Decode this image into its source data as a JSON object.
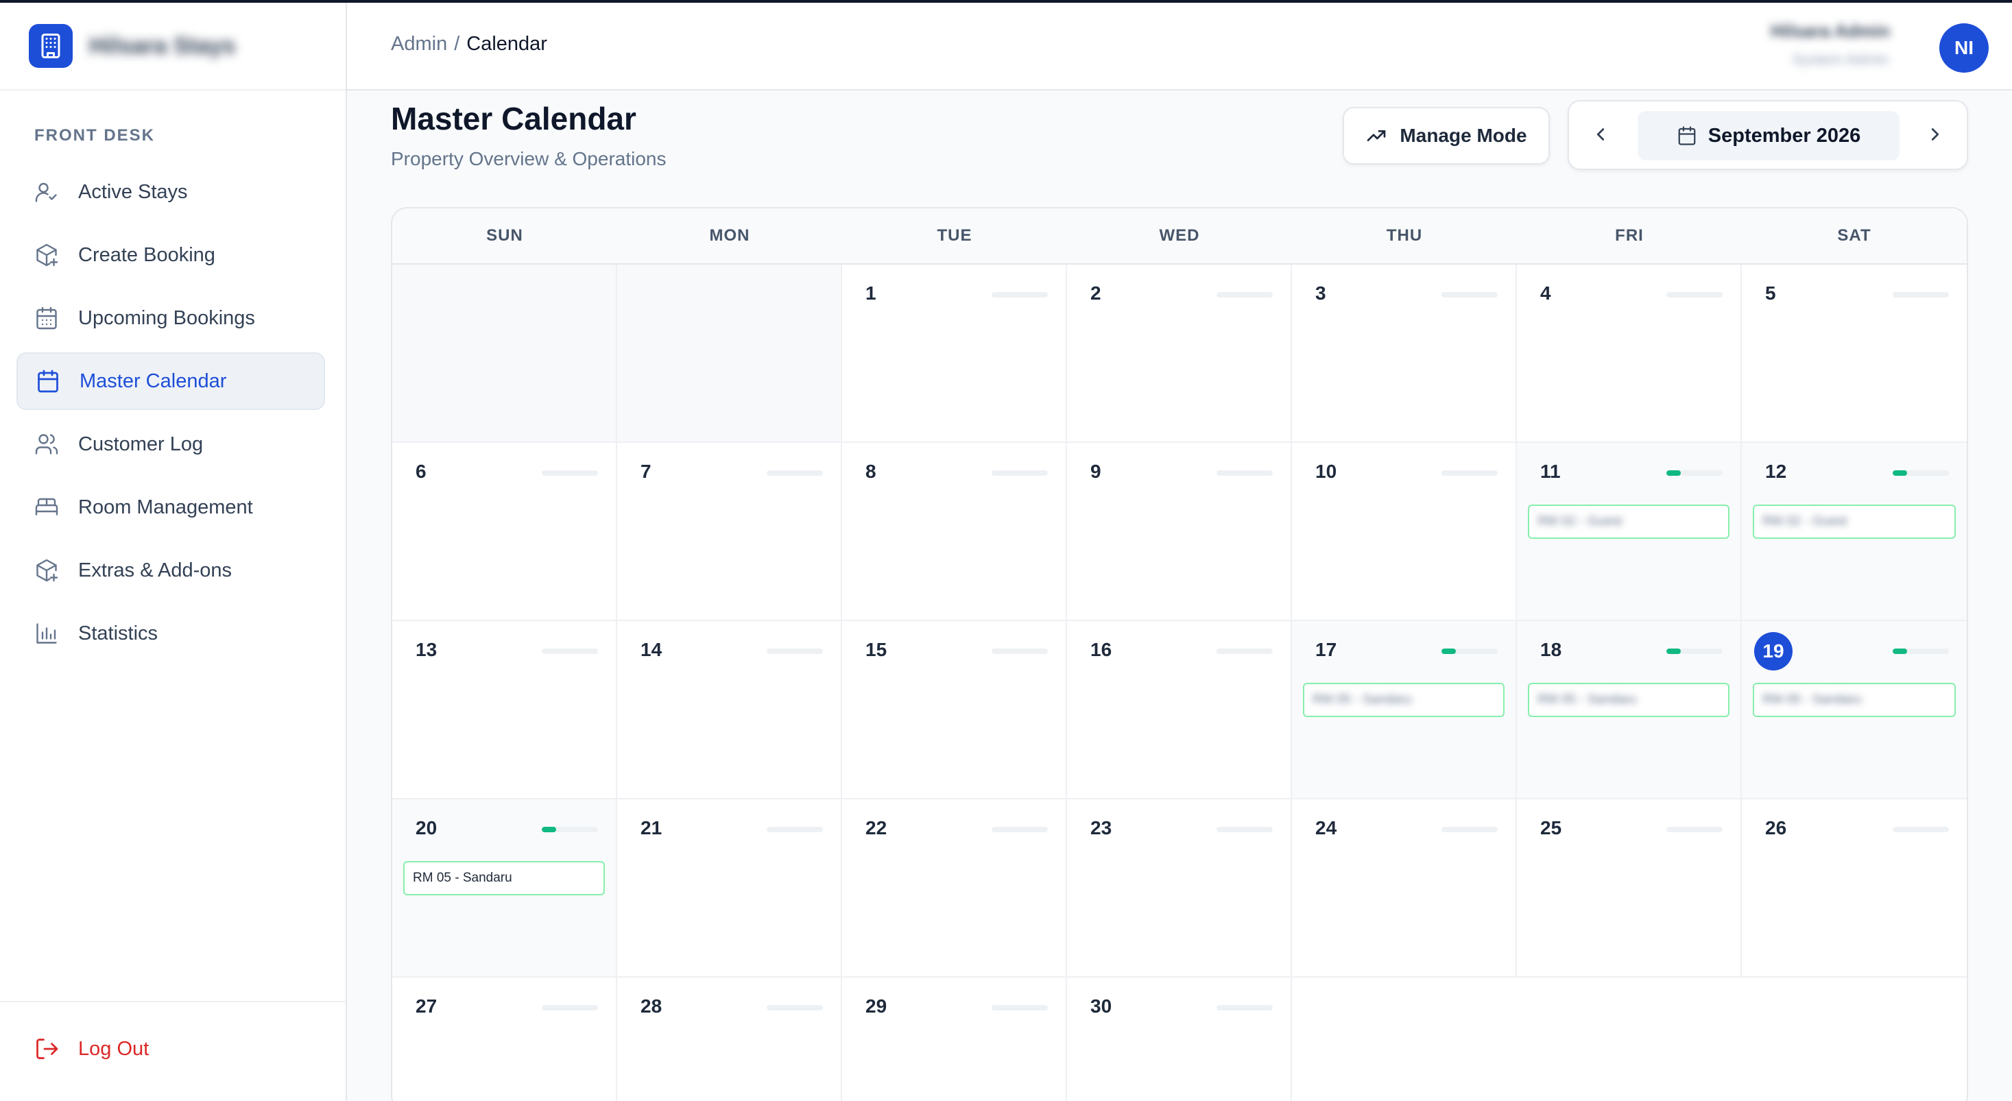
{
  "brand": {
    "name": "Hilsara Stays"
  },
  "sidebar": {
    "section_label": "FRONT DESK",
    "items": [
      {
        "label": "Active Stays",
        "icon": "user-check-icon",
        "active": false
      },
      {
        "label": "Create Booking",
        "icon": "package-plus-icon",
        "active": false
      },
      {
        "label": "Upcoming Bookings",
        "icon": "calendar-days-icon",
        "active": false
      },
      {
        "label": "Master Calendar",
        "icon": "calendar-icon",
        "active": true
      },
      {
        "label": "Customer Log",
        "icon": "users-icon",
        "active": false
      },
      {
        "label": "Room Management",
        "icon": "bed-icon",
        "active": false
      },
      {
        "label": "Extras & Add-ons",
        "icon": "package-plus-icon",
        "active": false
      },
      {
        "label": "Statistics",
        "icon": "bar-chart-icon",
        "active": false
      }
    ],
    "logout_label": "Log Out"
  },
  "header": {
    "breadcrumb_root": "Admin",
    "breadcrumb_separator": "/",
    "breadcrumb_current": "Calendar",
    "user_name": "Hilsara Admin",
    "user_role": "System Admin",
    "avatar_initials": "NI"
  },
  "page": {
    "title": "Master Calendar",
    "subtitle": "Property Overview & Operations",
    "manage_mode_label": "Manage Mode",
    "month_label": "September 2026"
  },
  "calendar": {
    "weekdays": [
      "SUN",
      "MON",
      "TUE",
      "WED",
      "THU",
      "FRI",
      "SAT"
    ],
    "today": 19,
    "cells": [
      {
        "type": "empty"
      },
      {
        "type": "empty"
      },
      {
        "day": "1",
        "occupancy": 0
      },
      {
        "day": "2",
        "occupancy": 0
      },
      {
        "day": "3",
        "occupancy": 0
      },
      {
        "day": "4",
        "occupancy": 0
      },
      {
        "day": "5",
        "occupancy": 0
      },
      {
        "day": "6",
        "occupancy": 0
      },
      {
        "day": "7",
        "occupancy": 0
      },
      {
        "day": "8",
        "occupancy": 0
      },
      {
        "day": "9",
        "occupancy": 0
      },
      {
        "day": "10",
        "occupancy": 0
      },
      {
        "day": "11",
        "occupancy": 0.25,
        "booking": "RM 02 - Guest",
        "blurred": true
      },
      {
        "day": "12",
        "occupancy": 0.25,
        "booking": "RM 02 - Guest",
        "blurred": true
      },
      {
        "day": "13",
        "occupancy": 0
      },
      {
        "day": "14",
        "occupancy": 0
      },
      {
        "day": "15",
        "occupancy": 0
      },
      {
        "day": "16",
        "occupancy": 0
      },
      {
        "day": "17",
        "occupancy": 0.25,
        "booking": "RM 05 - Sandaru",
        "blurred": true
      },
      {
        "day": "18",
        "occupancy": 0.25,
        "booking": "RM 05 - Sandaru",
        "blurred": true
      },
      {
        "day": "19",
        "occupancy": 0.25,
        "booking": "RM 05 - Sandaru",
        "blurred": true,
        "today": true
      },
      {
        "day": "20",
        "occupancy": 0.25,
        "booking": "RM 05 - Sandaru",
        "blurred": false
      },
      {
        "day": "21",
        "occupancy": 0
      },
      {
        "day": "22",
        "occupancy": 0
      },
      {
        "day": "23",
        "occupancy": 0
      },
      {
        "day": "24",
        "occupancy": 0
      },
      {
        "day": "25",
        "occupancy": 0
      },
      {
        "day": "26",
        "occupancy": 0
      },
      {
        "day": "27",
        "occupancy": 0
      },
      {
        "day": "28",
        "occupancy": 0
      },
      {
        "day": "29",
        "occupancy": 0
      },
      {
        "day": "30",
        "occupancy": 0
      },
      {
        "type": "blank"
      },
      {
        "type": "blank"
      },
      {
        "type": "blank"
      }
    ]
  },
  "colors": {
    "accent": "#1d4ed8",
    "occupancy": "#10b981",
    "booking_border": "#86efac",
    "logout": "#dc2626"
  }
}
